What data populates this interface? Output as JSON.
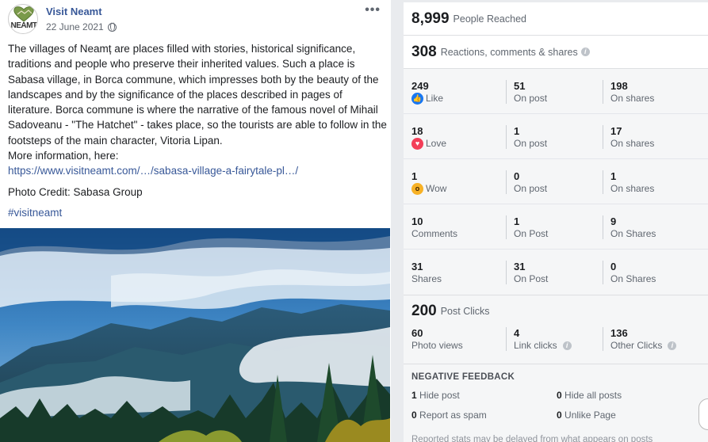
{
  "post": {
    "page_name": "Visit Neamt",
    "logo_text": "NEAMT",
    "date": "22 June 2021",
    "body": "The villages of Neamț are places filled with stories, historical significance, traditions and people who preserve their inherited values. Such a place is Sabasa village, in Borca commune, which impresses both by the beauty of the landscapes and by the significance of the places described in pages of literature. Borca commune is where the narrative of the famous novel of Mihail Sadoveanu - \"The Hatchet\" - takes place, so the tourists are able to follow in the footsteps of the main character, Vitoria Lipan.",
    "more_info": "More information, here:",
    "link": "https://www.visitneamt.com/…/sabasa-village-a-fairytale-pl…/",
    "credit": "Photo Credit: Sabasa Group",
    "hashtag": "#visitneamt",
    "more_icon": "more-dots-icon",
    "globe_icon": "globe-icon"
  },
  "stats": {
    "reached": {
      "value": "8,999",
      "label": "People Reached"
    },
    "reactions": {
      "value": "308",
      "label": "Reactions, comments & shares"
    },
    "rows": [
      {
        "c1": {
          "num": "249",
          "label": "Like",
          "icon": "like-icon"
        },
        "c2": {
          "num": "51",
          "label": "On post"
        },
        "c3": {
          "num": "198",
          "label": "On shares"
        }
      },
      {
        "c1": {
          "num": "18",
          "label": "Love",
          "icon": "love-icon"
        },
        "c2": {
          "num": "1",
          "label": "On post"
        },
        "c3": {
          "num": "17",
          "label": "On shares"
        }
      },
      {
        "c1": {
          "num": "1",
          "label": "Wow",
          "icon": "wow-icon"
        },
        "c2": {
          "num": "0",
          "label": "On post"
        },
        "c3": {
          "num": "1",
          "label": "On shares"
        }
      },
      {
        "c1": {
          "num": "10",
          "label": "Comments"
        },
        "c2": {
          "num": "1",
          "label": "On Post"
        },
        "c3": {
          "num": "9",
          "label": "On Shares"
        }
      },
      {
        "c1": {
          "num": "31",
          "label": "Shares"
        },
        "c2": {
          "num": "31",
          "label": "On Post"
        },
        "c3": {
          "num": "0",
          "label": "On Shares"
        }
      }
    ],
    "post_clicks": {
      "value": "200",
      "label": "Post Clicks"
    },
    "clicks": {
      "c1": {
        "num": "60",
        "label": "Photo views"
      },
      "c2": {
        "num": "4",
        "label": "Link clicks"
      },
      "c3": {
        "num": "136",
        "label": "Other Clicks"
      }
    },
    "negative": {
      "title": "NEGATIVE FEEDBACK",
      "items": [
        {
          "num": "1",
          "label": "Hide post"
        },
        {
          "num": "0",
          "label": "Hide all posts"
        },
        {
          "num": "0",
          "label": "Report as spam"
        },
        {
          "num": "0",
          "label": "Unlike Page"
        }
      ]
    },
    "footnote": "Reported stats may be delayed from what appears on posts"
  },
  "colors": {
    "link": "#385898",
    "like": "#1877f2",
    "love": "#f33e58",
    "wow": "#f7b125"
  }
}
